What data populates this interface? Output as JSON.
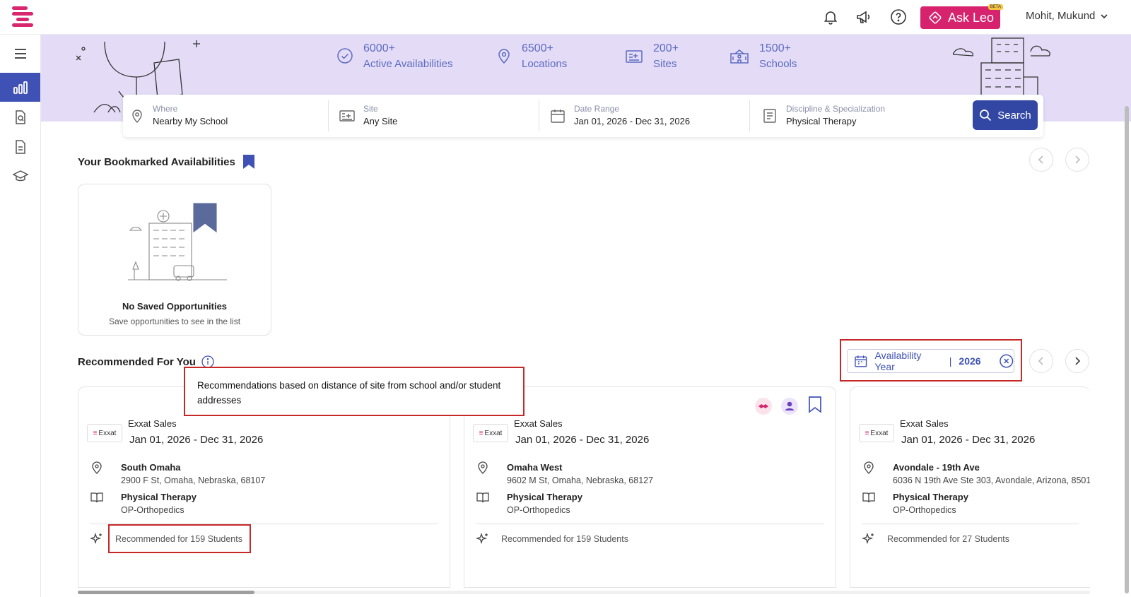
{
  "header": {
    "ask_leo_label": "Ask Leo",
    "beta_badge": "BETA",
    "user_name": "Mohit, Mukund",
    "icons": [
      "bell-icon",
      "megaphone-icon",
      "help-icon",
      "chevron-down-icon"
    ]
  },
  "sidebar": {
    "items": [
      {
        "name": "menu-icon"
      },
      {
        "name": "dashboard-chart-icon",
        "active": true
      },
      {
        "name": "document-search-icon"
      },
      {
        "name": "document-icon"
      },
      {
        "name": "graduation-cap-icon"
      }
    ]
  },
  "stats": [
    {
      "number": "6000+",
      "label": "Active Availabilities",
      "icon": "check-circle-icon"
    },
    {
      "number": "6500+",
      "label": "Locations",
      "icon": "location-pin-icon"
    },
    {
      "number": "200+",
      "label": "Sites",
      "icon": "sites-icon"
    },
    {
      "number": "1500+",
      "label": "Schools",
      "icon": "school-icon"
    }
  ],
  "search": {
    "where_caption": "Where",
    "where_value": "Nearby My School",
    "site_caption": "Site",
    "site_value": "Any Site",
    "date_caption": "Date Range",
    "date_value": "Jan 01, 2026 - Dec 31, 2026",
    "discipline_caption": "Discipline & Specialization",
    "discipline_value": "Physical Therapy",
    "button_label": "Search"
  },
  "bookmarked": {
    "title": "Your Bookmarked Availabilities",
    "empty_title": "No Saved Opportunities",
    "empty_subtitle": "Save opportunities to see in the list"
  },
  "recommended": {
    "title": "Recommended For You",
    "tooltip": "Recommendations based on distance of site from school and/or student addresses",
    "filter_label": "Availability Year",
    "filter_sep": "|",
    "filter_value": "2026",
    "cards": [
      {
        "org": "Exxat Sales",
        "logo_text": "Exxat",
        "dates": "Jan 01, 2026 - Dec 31, 2026",
        "location_name": "South Omaha",
        "address": "2900 F St, Omaha, Nebraska, 68107",
        "discipline": "Physical Therapy",
        "specialization": "OP-Orthopedics",
        "recommendation": "Recommended for 159 Students"
      },
      {
        "org": "Exxat Sales",
        "logo_text": "Exxat",
        "dates": "Jan 01, 2026 - Dec 31, 2026",
        "location_name": "Omaha West",
        "address": "9602 M St, Omaha, Nebraska, 68127",
        "discipline": "Physical Therapy",
        "specialization": "OP-Orthopedics",
        "recommendation": "Recommended for 159 Students"
      },
      {
        "org": "Exxat Sales",
        "logo_text": "Exxat",
        "dates": "Jan 01, 2026 - Dec 31, 2026",
        "location_name": "Avondale - 19th Ave",
        "address": "6036 N 19th Ave Ste 303, Avondale, Arizona, 8501",
        "discipline": "Physical Therapy",
        "specialization": "OP-Orthopedics",
        "recommendation": "Recommended for 27 Students"
      }
    ]
  },
  "colors": {
    "brand_pink": "#d7236e",
    "primary_blue": "#3147a3",
    "hero_bg": "#e4dcf7",
    "highlight_red": "#c62828"
  }
}
